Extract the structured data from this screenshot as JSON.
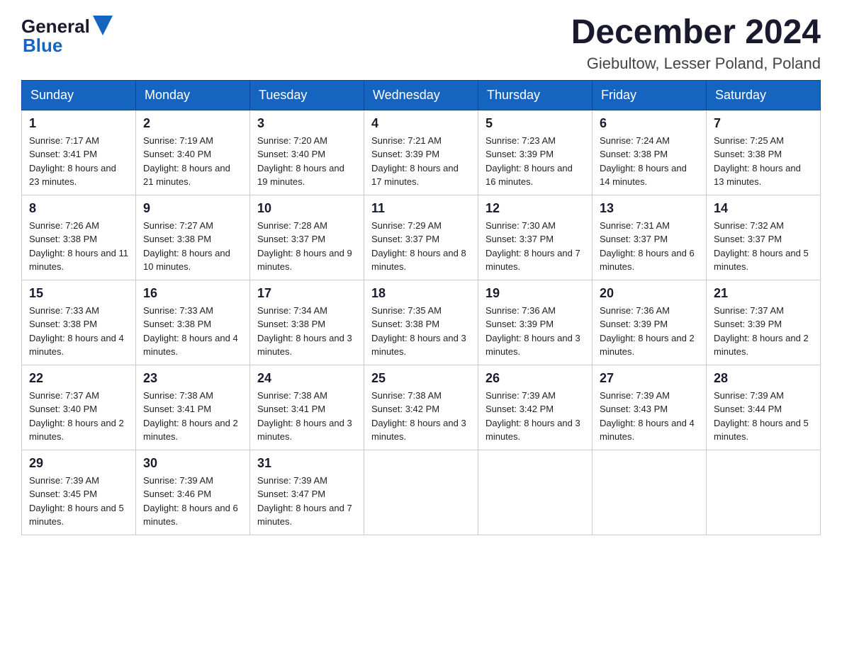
{
  "header": {
    "logo_general": "General",
    "logo_blue": "Blue",
    "month_title": "December 2024",
    "location": "Giebultow, Lesser Poland, Poland"
  },
  "weekdays": [
    "Sunday",
    "Monday",
    "Tuesday",
    "Wednesday",
    "Thursday",
    "Friday",
    "Saturday"
  ],
  "weeks": [
    [
      {
        "day": "1",
        "sunrise": "Sunrise: 7:17 AM",
        "sunset": "Sunset: 3:41 PM",
        "daylight": "Daylight: 8 hours and 23 minutes."
      },
      {
        "day": "2",
        "sunrise": "Sunrise: 7:19 AM",
        "sunset": "Sunset: 3:40 PM",
        "daylight": "Daylight: 8 hours and 21 minutes."
      },
      {
        "day": "3",
        "sunrise": "Sunrise: 7:20 AM",
        "sunset": "Sunset: 3:40 PM",
        "daylight": "Daylight: 8 hours and 19 minutes."
      },
      {
        "day": "4",
        "sunrise": "Sunrise: 7:21 AM",
        "sunset": "Sunset: 3:39 PM",
        "daylight": "Daylight: 8 hours and 17 minutes."
      },
      {
        "day": "5",
        "sunrise": "Sunrise: 7:23 AM",
        "sunset": "Sunset: 3:39 PM",
        "daylight": "Daylight: 8 hours and 16 minutes."
      },
      {
        "day": "6",
        "sunrise": "Sunrise: 7:24 AM",
        "sunset": "Sunset: 3:38 PM",
        "daylight": "Daylight: 8 hours and 14 minutes."
      },
      {
        "day": "7",
        "sunrise": "Sunrise: 7:25 AM",
        "sunset": "Sunset: 3:38 PM",
        "daylight": "Daylight: 8 hours and 13 minutes."
      }
    ],
    [
      {
        "day": "8",
        "sunrise": "Sunrise: 7:26 AM",
        "sunset": "Sunset: 3:38 PM",
        "daylight": "Daylight: 8 hours and 11 minutes."
      },
      {
        "day": "9",
        "sunrise": "Sunrise: 7:27 AM",
        "sunset": "Sunset: 3:38 PM",
        "daylight": "Daylight: 8 hours and 10 minutes."
      },
      {
        "day": "10",
        "sunrise": "Sunrise: 7:28 AM",
        "sunset": "Sunset: 3:37 PM",
        "daylight": "Daylight: 8 hours and 9 minutes."
      },
      {
        "day": "11",
        "sunrise": "Sunrise: 7:29 AM",
        "sunset": "Sunset: 3:37 PM",
        "daylight": "Daylight: 8 hours and 8 minutes."
      },
      {
        "day": "12",
        "sunrise": "Sunrise: 7:30 AM",
        "sunset": "Sunset: 3:37 PM",
        "daylight": "Daylight: 8 hours and 7 minutes."
      },
      {
        "day": "13",
        "sunrise": "Sunrise: 7:31 AM",
        "sunset": "Sunset: 3:37 PM",
        "daylight": "Daylight: 8 hours and 6 minutes."
      },
      {
        "day": "14",
        "sunrise": "Sunrise: 7:32 AM",
        "sunset": "Sunset: 3:37 PM",
        "daylight": "Daylight: 8 hours and 5 minutes."
      }
    ],
    [
      {
        "day": "15",
        "sunrise": "Sunrise: 7:33 AM",
        "sunset": "Sunset: 3:38 PM",
        "daylight": "Daylight: 8 hours and 4 minutes."
      },
      {
        "day": "16",
        "sunrise": "Sunrise: 7:33 AM",
        "sunset": "Sunset: 3:38 PM",
        "daylight": "Daylight: 8 hours and 4 minutes."
      },
      {
        "day": "17",
        "sunrise": "Sunrise: 7:34 AM",
        "sunset": "Sunset: 3:38 PM",
        "daylight": "Daylight: 8 hours and 3 minutes."
      },
      {
        "day": "18",
        "sunrise": "Sunrise: 7:35 AM",
        "sunset": "Sunset: 3:38 PM",
        "daylight": "Daylight: 8 hours and 3 minutes."
      },
      {
        "day": "19",
        "sunrise": "Sunrise: 7:36 AM",
        "sunset": "Sunset: 3:39 PM",
        "daylight": "Daylight: 8 hours and 3 minutes."
      },
      {
        "day": "20",
        "sunrise": "Sunrise: 7:36 AM",
        "sunset": "Sunset: 3:39 PM",
        "daylight": "Daylight: 8 hours and 2 minutes."
      },
      {
        "day": "21",
        "sunrise": "Sunrise: 7:37 AM",
        "sunset": "Sunset: 3:39 PM",
        "daylight": "Daylight: 8 hours and 2 minutes."
      }
    ],
    [
      {
        "day": "22",
        "sunrise": "Sunrise: 7:37 AM",
        "sunset": "Sunset: 3:40 PM",
        "daylight": "Daylight: 8 hours and 2 minutes."
      },
      {
        "day": "23",
        "sunrise": "Sunrise: 7:38 AM",
        "sunset": "Sunset: 3:41 PM",
        "daylight": "Daylight: 8 hours and 2 minutes."
      },
      {
        "day": "24",
        "sunrise": "Sunrise: 7:38 AM",
        "sunset": "Sunset: 3:41 PM",
        "daylight": "Daylight: 8 hours and 3 minutes."
      },
      {
        "day": "25",
        "sunrise": "Sunrise: 7:38 AM",
        "sunset": "Sunset: 3:42 PM",
        "daylight": "Daylight: 8 hours and 3 minutes."
      },
      {
        "day": "26",
        "sunrise": "Sunrise: 7:39 AM",
        "sunset": "Sunset: 3:42 PM",
        "daylight": "Daylight: 8 hours and 3 minutes."
      },
      {
        "day": "27",
        "sunrise": "Sunrise: 7:39 AM",
        "sunset": "Sunset: 3:43 PM",
        "daylight": "Daylight: 8 hours and 4 minutes."
      },
      {
        "day": "28",
        "sunrise": "Sunrise: 7:39 AM",
        "sunset": "Sunset: 3:44 PM",
        "daylight": "Daylight: 8 hours and 5 minutes."
      }
    ],
    [
      {
        "day": "29",
        "sunrise": "Sunrise: 7:39 AM",
        "sunset": "Sunset: 3:45 PM",
        "daylight": "Daylight: 8 hours and 5 minutes."
      },
      {
        "day": "30",
        "sunrise": "Sunrise: 7:39 AM",
        "sunset": "Sunset: 3:46 PM",
        "daylight": "Daylight: 8 hours and 6 minutes."
      },
      {
        "day": "31",
        "sunrise": "Sunrise: 7:39 AM",
        "sunset": "Sunset: 3:47 PM",
        "daylight": "Daylight: 8 hours and 7 minutes."
      },
      null,
      null,
      null,
      null
    ]
  ]
}
